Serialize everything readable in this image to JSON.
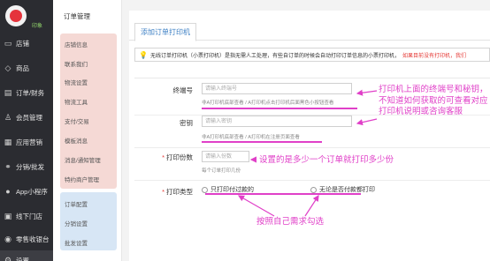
{
  "sidebar": {
    "logo_label": "印象",
    "items": [
      {
        "label": "店铺",
        "icon": "store-icon"
      },
      {
        "label": "商品",
        "icon": "goods-icon"
      },
      {
        "label": "订单/财务",
        "icon": "order-icon"
      },
      {
        "label": "会员管理",
        "icon": "member-icon"
      },
      {
        "label": "应用营销",
        "icon": "apps-icon"
      },
      {
        "label": "分销/批发",
        "icon": "share-icon"
      },
      {
        "label": "App小程序",
        "icon": "app-icon"
      },
      {
        "label": "线下门店",
        "icon": "offline-store-icon"
      },
      {
        "label": "零售收银台",
        "icon": "cashier-icon"
      },
      {
        "label": "设置",
        "icon": "gear-icon"
      }
    ]
  },
  "submenu": {
    "title": "订单管理",
    "group1": [
      "店铺信息",
      "联系我们",
      "物流设置",
      "物流工具",
      "支付/交易",
      "模板消息",
      "消息/通知管理",
      "特约商户管理"
    ],
    "group2": [
      "订单配置",
      "分销设置",
      "批发设置"
    ]
  },
  "main": {
    "tab": "添加订单打印机",
    "notice_text": "无线订单打印机（小票打印机）是指无需人工处理，有些自订单的时候会自动打印订单信息的小票打印机，",
    "notice_red": "如果目前没有打印机，我们"
  },
  "form": {
    "terminal_label": "终端号",
    "terminal_placeholder": "请输入终端号",
    "terminal_help": "非A打印机底部查看 / A打印机点击打印机后面黑色小按钮查看",
    "key_label": "密钥",
    "key_placeholder": "请输入密钥",
    "key_help": "非A打印机底部查看 / A打印机在注册页面查看",
    "copies_label": "打印份数",
    "copies_placeholder": "请输入份数",
    "copies_help": "每个订单打印几份",
    "type_label": "打印类型",
    "type_option1": "只打印付过款的",
    "type_option2": "无论是否付款都打印"
  },
  "annotations": {
    "terminal_note": "打印机上面的终端号和秘钥，不知道如何获取的可查看对应打印机说明或咨询客服",
    "copies_note": "设置的是多少一个订单就打印多少份",
    "type_note": "按照自己需求勾选"
  }
}
